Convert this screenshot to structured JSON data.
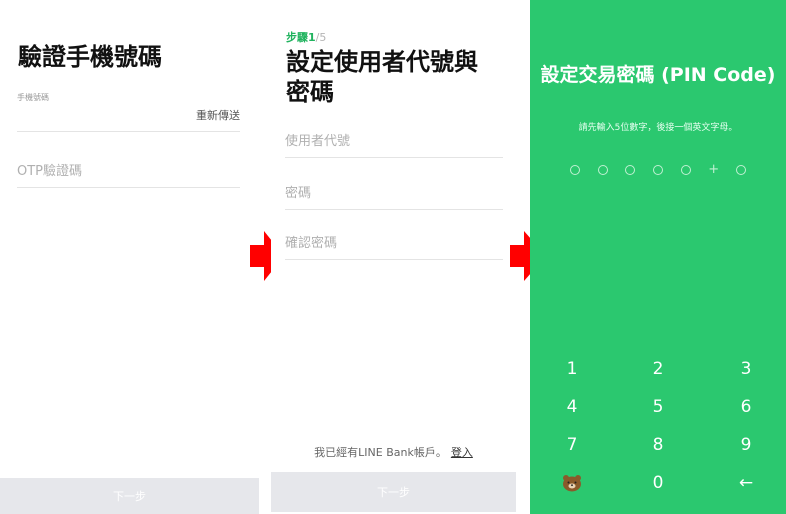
{
  "screen1": {
    "title": "驗證手機號碼",
    "phone_label": "手機號碼",
    "resend_label": "重新傳送",
    "otp_placeholder": "OTP驗證碼",
    "next_label": "下一步"
  },
  "screen2": {
    "step_current": "步驟1",
    "step_total": "/5",
    "title": "設定使用者代號與密碼",
    "user_id_placeholder": "使用者代號",
    "password_placeholder": "密碼",
    "confirm_password_placeholder": "確認密碼",
    "have_account_text": "我已經有LINE Bank帳戶。",
    "login_label": "登入",
    "next_label": "下一步"
  },
  "screen3": {
    "title": "設定交易密碼 (PIN Code)",
    "hint": "請先輸入5位數字，後接一個英文字母。",
    "keys": [
      "1",
      "2",
      "3",
      "4",
      "5",
      "6",
      "7",
      "8",
      "9",
      "0",
      "←"
    ],
    "bear_icon": "bear-icon",
    "backspace_icon": "backspace-arrow-icon"
  },
  "colors": {
    "accent_green": "#2bc86f",
    "arrow_red": "#ff0000",
    "disabled_button": "#e6e7eb"
  }
}
